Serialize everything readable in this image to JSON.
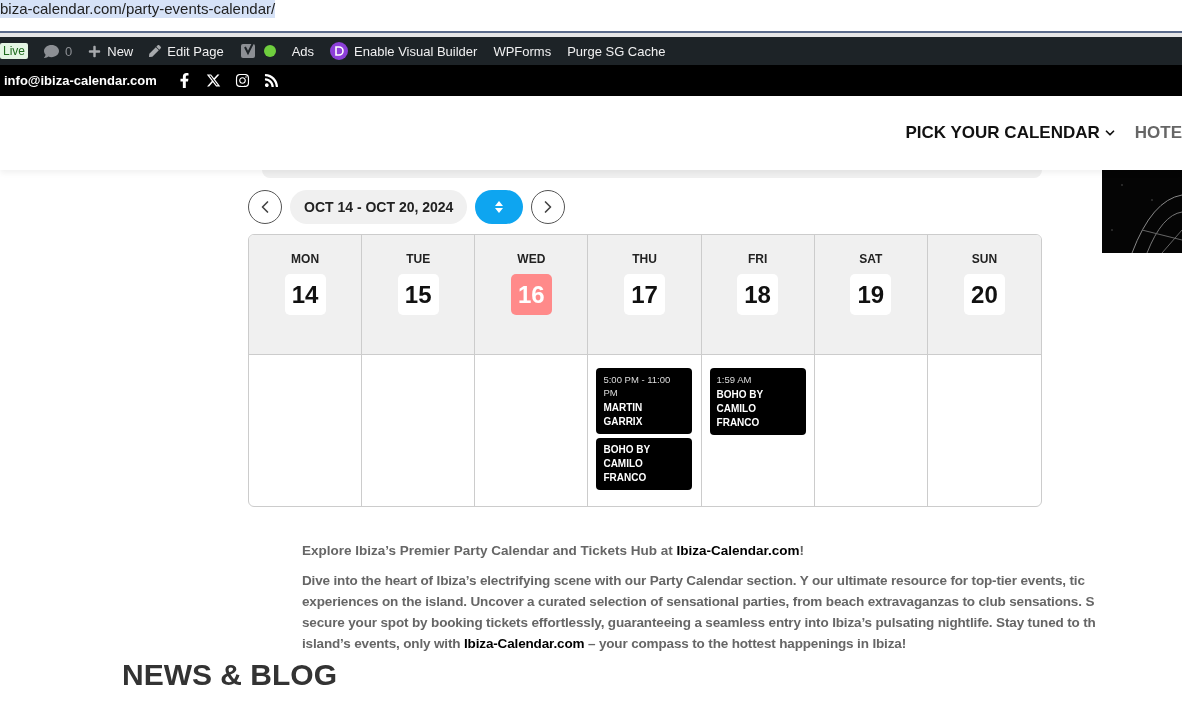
{
  "address_bar": {
    "url": "biza-calendar.com/party-events-calendar/"
  },
  "admin_bar": {
    "items": [
      {
        "kind": "badge",
        "label": "Live"
      },
      {
        "kind": "comments",
        "label": "0"
      },
      {
        "kind": "new",
        "label": "New"
      },
      {
        "kind": "edit",
        "label": "Edit Page"
      },
      {
        "kind": "seo"
      },
      {
        "kind": "text",
        "label": "Ads"
      },
      {
        "kind": "divi",
        "label": "Enable Visual Builder"
      },
      {
        "kind": "text",
        "label": "WPForms"
      },
      {
        "kind": "text",
        "label": "Purge SG Cache"
      }
    ]
  },
  "top_bar": {
    "email": "info@ibiza-calendar.com"
  },
  "nav": {
    "items": [
      {
        "label": "PICK YOUR CALENDAR",
        "dropdown": true
      },
      {
        "label": "HOTE",
        "dropdown": false
      }
    ]
  },
  "calendar": {
    "range": "OCT 14 - OCT 20, 2024",
    "days": [
      {
        "weekday": "MON",
        "date": "14",
        "selected": false
      },
      {
        "weekday": "TUE",
        "date": "15",
        "selected": false
      },
      {
        "weekday": "WED",
        "date": "16",
        "selected": true
      },
      {
        "weekday": "THU",
        "date": "17",
        "selected": false,
        "events": [
          {
            "time": "5:00 PM - 11:00 PM",
            "title": "MARTIN GARRIX"
          },
          {
            "title": "BOHO BY CAMILO FRANCO"
          }
        ]
      },
      {
        "weekday": "FRI",
        "date": "18",
        "selected": false,
        "events": [
          {
            "time": "1:59 AM",
            "title": "BOHO BY CAMILO FRANCO"
          }
        ]
      },
      {
        "weekday": "SAT",
        "date": "19",
        "selected": false
      },
      {
        "weekday": "SUN",
        "date": "20",
        "selected": false
      }
    ]
  },
  "intro": {
    "lead": "Explore Ibiza’s Premier Party Calendar and Tickets Hub at **Ibiza-Calendar.com**!",
    "lines": [
      "Dive into the heart of Ibiza’s electrifying scene with our Party Calendar section. Y our ultimate resource for top-tier events, tic",
      "experiences on the island. Uncover a curated selection of sensational parties, from beach extravaganzas to club sensations. S",
      "secure your spot by booking tickets effortlessly, guaranteeing a seamless entry into Ibiza’s pulsating nightlife. Stay tuned to th",
      "island’s events, only with **Ibiza-Calendar.com** – your compass to the hottest happenings in Ibiza!"
    ]
  },
  "news_heading": "NEWS & BLOG"
}
